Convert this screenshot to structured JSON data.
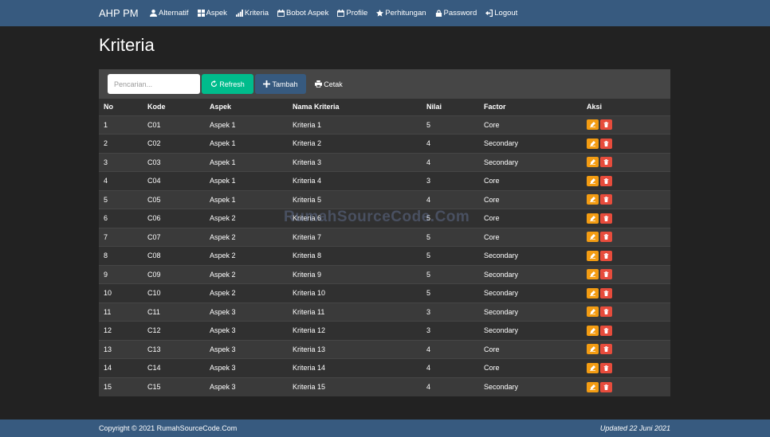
{
  "navbar": {
    "brand": "AHP PM",
    "items": [
      {
        "label": "Alternatif",
        "icon": "user-icon"
      },
      {
        "label": "Aspek",
        "icon": "grid-icon"
      },
      {
        "label": "Kriteria",
        "icon": "signal-icon"
      },
      {
        "label": "Bobot Aspek",
        "icon": "calendar-icon"
      },
      {
        "label": "Profile",
        "icon": "calendar-icon"
      },
      {
        "label": "Perhitungan",
        "icon": "star-icon"
      },
      {
        "label": "Password",
        "icon": "lock-icon"
      },
      {
        "label": "Logout",
        "icon": "logout-icon"
      }
    ]
  },
  "page": {
    "title": "Kriteria"
  },
  "toolbar": {
    "search_placeholder": "Pencarian...",
    "refresh_label": "Refresh",
    "add_label": "Tambah",
    "print_label": "Cetak"
  },
  "table": {
    "headers": [
      "No",
      "Kode",
      "Aspek",
      "Nama Kriteria",
      "Nilai",
      "Factor",
      "Aksi"
    ],
    "rows": [
      {
        "no": "1",
        "kode": "C01",
        "aspek": "Aspek 1",
        "nama": "Kriteria 1",
        "nilai": "5",
        "factor": "Core"
      },
      {
        "no": "2",
        "kode": "C02",
        "aspek": "Aspek 1",
        "nama": "Kriteria 2",
        "nilai": "4",
        "factor": "Secondary"
      },
      {
        "no": "3",
        "kode": "C03",
        "aspek": "Aspek 1",
        "nama": "Kriteria 3",
        "nilai": "4",
        "factor": "Secondary"
      },
      {
        "no": "4",
        "kode": "C04",
        "aspek": "Aspek 1",
        "nama": "Kriteria 4",
        "nilai": "3",
        "factor": "Core"
      },
      {
        "no": "5",
        "kode": "C05",
        "aspek": "Aspek 1",
        "nama": "Kriteria 5",
        "nilai": "4",
        "factor": "Core"
      },
      {
        "no": "6",
        "kode": "C06",
        "aspek": "Aspek 2",
        "nama": "Kriteria 6",
        "nilai": "5",
        "factor": "Core"
      },
      {
        "no": "7",
        "kode": "C07",
        "aspek": "Aspek 2",
        "nama": "Kriteria 7",
        "nilai": "5",
        "factor": "Core"
      },
      {
        "no": "8",
        "kode": "C08",
        "aspek": "Aspek 2",
        "nama": "Kriteria 8",
        "nilai": "5",
        "factor": "Secondary"
      },
      {
        "no": "9",
        "kode": "C09",
        "aspek": "Aspek 2",
        "nama": "Kriteria 9",
        "nilai": "5",
        "factor": "Secondary"
      },
      {
        "no": "10",
        "kode": "C10",
        "aspek": "Aspek 2",
        "nama": "Kriteria 10",
        "nilai": "5",
        "factor": "Secondary"
      },
      {
        "no": "11",
        "kode": "C11",
        "aspek": "Aspek 3",
        "nama": "Kriteria 11",
        "nilai": "3",
        "factor": "Secondary"
      },
      {
        "no": "12",
        "kode": "C12",
        "aspek": "Aspek 3",
        "nama": "Kriteria 12",
        "nilai": "3",
        "factor": "Secondary"
      },
      {
        "no": "13",
        "kode": "C13",
        "aspek": "Aspek 3",
        "nama": "Kriteria 13",
        "nilai": "4",
        "factor": "Core"
      },
      {
        "no": "14",
        "kode": "C14",
        "aspek": "Aspek 3",
        "nama": "Kriteria 14",
        "nilai": "4",
        "factor": "Core"
      },
      {
        "no": "15",
        "kode": "C15",
        "aspek": "Aspek 3",
        "nama": "Kriteria 15",
        "nilai": "4",
        "factor": "Secondary"
      }
    ]
  },
  "watermark": "RumahSourceCode.Com",
  "footer": {
    "copyright": "Copyright © 2021 RumahSourceCode.Com",
    "updated": "Updated 22 Juni 2021"
  },
  "colors": {
    "navbar": "#375a7f",
    "background": "#222222",
    "refresh": "#00bc8c",
    "edit": "#f39c12",
    "delete": "#e74c3c"
  }
}
